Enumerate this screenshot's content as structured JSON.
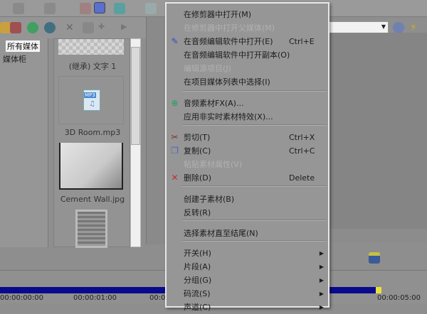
{
  "media_tree": {
    "items": [
      "所有媒体",
      "媒体柜"
    ]
  },
  "media_files": [
    "(继承) 文字 1",
    "3D Room.mp3",
    "Cement Wall.jpg"
  ],
  "mp3_badge": "MP3",
  "timeline": {
    "timecodes": [
      "00:00:00:00",
      "00:00:01:00",
      "00:0",
      "00:00:05:00"
    ]
  },
  "context_menu": {
    "items": [
      {
        "label": "在修剪器中打开(M)",
        "shortcut": "",
        "disabled": false
      },
      {
        "label": "在修剪器中打开父媒体(M)",
        "shortcut": "",
        "disabled": true
      },
      {
        "label": "在音频编辑软件中打开(E)",
        "shortcut": "Ctrl+E",
        "disabled": false,
        "icon": "pencil-icon"
      },
      {
        "label": "在音频编辑软件中打开副本(O)",
        "shortcut": "",
        "disabled": false
      },
      {
        "label": "编辑源项目(J)",
        "shortcut": "",
        "disabled": true
      },
      {
        "label": "在项目媒体列表中选择(I)",
        "shortcut": "",
        "disabled": false
      },
      {
        "label": "音频素材FX(A)...",
        "shortcut": "",
        "disabled": false,
        "icon": "fx-plugin-icon"
      },
      {
        "label": "应用非实时素材特效(X)...",
        "shortcut": "",
        "disabled": false
      },
      {
        "label": "剪切(T)",
        "shortcut": "Ctrl+X",
        "disabled": false,
        "icon": "scissors-icon"
      },
      {
        "label": "复制(C)",
        "shortcut": "Ctrl+C",
        "disabled": false,
        "icon": "copy-icon"
      },
      {
        "label": "粘贴素材属性(V)",
        "shortcut": "",
        "disabled": true
      },
      {
        "label": "删除(D)",
        "shortcut": "Delete",
        "disabled": false,
        "icon": "delete-icon"
      },
      {
        "label": "创建子素材(B)",
        "shortcut": "",
        "disabled": false
      },
      {
        "label": "反转(R)",
        "shortcut": "",
        "disabled": false
      },
      {
        "label": "选择素材直至结尾(N)",
        "shortcut": "",
        "disabled": false
      },
      {
        "label": "开关(H)",
        "shortcut": "",
        "disabled": false,
        "submenu": true
      },
      {
        "label": "片段(A)",
        "shortcut": "",
        "disabled": false,
        "submenu": true
      },
      {
        "label": "分组(G)",
        "shortcut": "",
        "disabled": false,
        "submenu": true
      },
      {
        "label": "码流(S)",
        "shortcut": "",
        "disabled": false,
        "submenu": true
      },
      {
        "label": "声道(C)",
        "shortcut": "",
        "disabled": false,
        "submenu": true
      }
    ]
  },
  "colors": {
    "timeline_bar": "#0a0a8c",
    "menu_bg": "#969696",
    "accent": "#3a5bd9"
  }
}
